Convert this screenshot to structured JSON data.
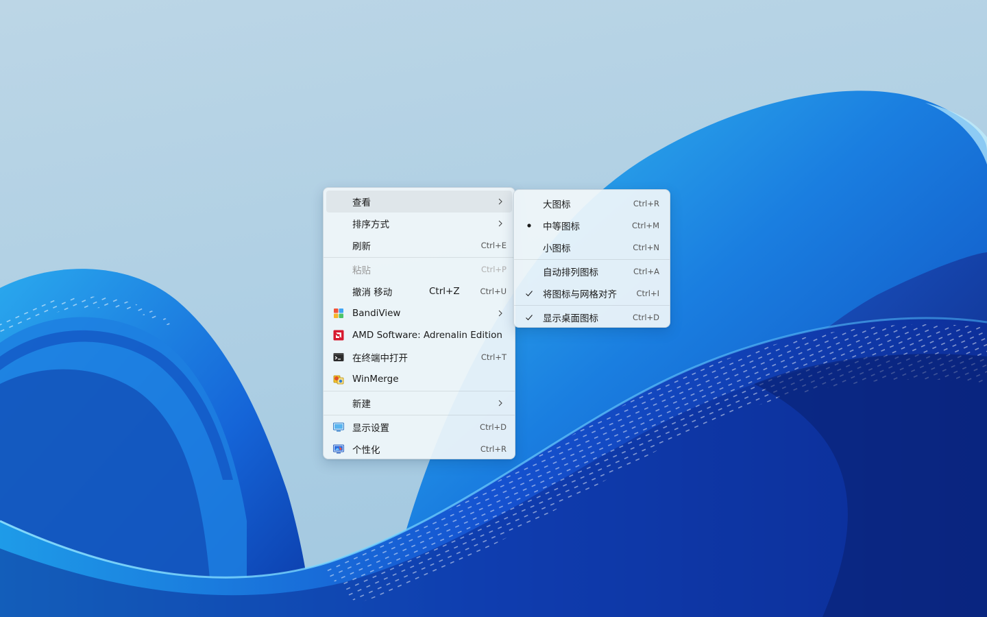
{
  "context_menu": {
    "items": [
      {
        "label": "查看",
        "shortcut": "",
        "has_submenu": true
      },
      {
        "label": "排序方式",
        "shortcut": "",
        "has_submenu": true
      },
      {
        "label": "刷新",
        "shortcut": "Ctrl+E"
      },
      {
        "label": "粘贴",
        "shortcut": "Ctrl+P",
        "disabled": true
      },
      {
        "label": "撤消 移动",
        "label_extra": "Ctrl+Z",
        "shortcut": "Ctrl+U"
      },
      {
        "label": "BandiView",
        "shortcut": "",
        "has_submenu": true,
        "icon": "bandiview-icon"
      },
      {
        "label": "AMD Software: Adrenalin Edition",
        "shortcut": "",
        "icon": "amd-icon"
      },
      {
        "label": "在终端中打开",
        "shortcut": "Ctrl+T",
        "icon": "terminal-icon"
      },
      {
        "label": "WinMerge",
        "shortcut": "",
        "icon": "winmerge-icon"
      },
      {
        "label": "新建",
        "shortcut": "",
        "has_submenu": true
      },
      {
        "label": "显示设置",
        "shortcut": "Ctrl+D",
        "icon": "display-settings-icon"
      },
      {
        "label": "个性化",
        "shortcut": "Ctrl+R",
        "icon": "personalize-icon"
      }
    ]
  },
  "view_submenu": {
    "items": [
      {
        "label": "大图标",
        "shortcut": "Ctrl+R",
        "mark": "none"
      },
      {
        "label": "中等图标",
        "shortcut": "Ctrl+M",
        "mark": "bullet"
      },
      {
        "label": "小图标",
        "shortcut": "Ctrl+N",
        "mark": "none"
      },
      {
        "label": "自动排列图标",
        "shortcut": "Ctrl+A",
        "mark": "none"
      },
      {
        "label": "将图标与网格对齐",
        "shortcut": "Ctrl+I",
        "mark": "check"
      },
      {
        "label": "显示桌面图标",
        "shortcut": "Ctrl+D",
        "mark": "check"
      }
    ]
  },
  "colors": {
    "menu_background": "#f0f6fa",
    "wallpaper_sky": "#b0d0e4",
    "wallpaper_ribbon_dark": "#0a2f9e",
    "wallpaper_ribbon_light": "#2fa8ef",
    "amd_red": "#d7192e"
  }
}
